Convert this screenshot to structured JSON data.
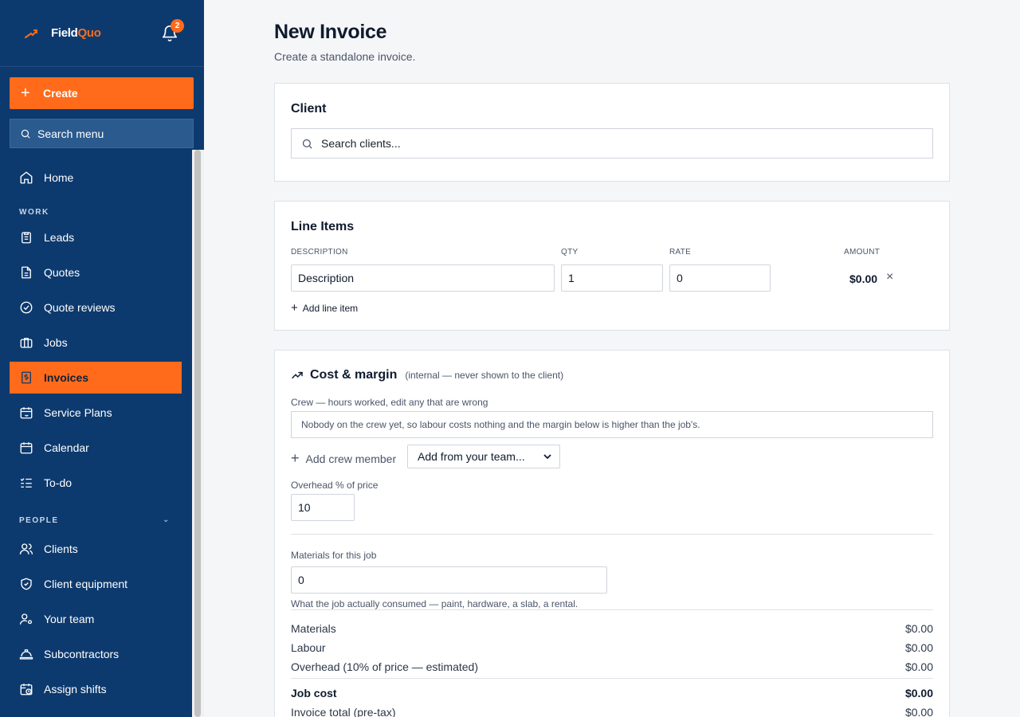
{
  "brand": {
    "name_part1": "Field",
    "name_part2": "Quo",
    "notification_count": "2"
  },
  "sidebar": {
    "create_label": "Create",
    "search_placeholder": "Search menu",
    "home": "Home",
    "section_work": "WORK",
    "work_items": [
      "Leads",
      "Quotes",
      "Quote reviews",
      "Jobs",
      "Invoices",
      "Service Plans",
      "Calendar",
      "To-do"
    ],
    "section_people": "PEOPLE",
    "people_items": [
      "Clients",
      "Client equipment",
      "Your team",
      "Subcontractors",
      "Assign shifts"
    ],
    "active_item": "Invoices"
  },
  "page": {
    "title": "New Invoice",
    "subtitle": "Create a standalone invoice."
  },
  "client": {
    "title": "Client",
    "search_placeholder": "Search clients..."
  },
  "line_items": {
    "title": "Line Items",
    "headers": {
      "description": "DESCRIPTION",
      "qty": "QTY",
      "rate": "RATE",
      "amount": "AMOUNT"
    },
    "rows": [
      {
        "description": "Description",
        "qty": "1",
        "rate": "0",
        "amount": "$0.00"
      }
    ],
    "add_label": "Add line item"
  },
  "cost_margin": {
    "title": "Cost & margin",
    "note": "(internal — never shown to the client)",
    "crew_label": "Crew — hours worked, edit any that are wrong",
    "crew_empty": "Nobody on the crew yet, so labour costs nothing and the margin below is higher than the job's.",
    "add_crew_label": "Add crew member",
    "team_select": "Add from your team...",
    "overhead_label": "Overhead % of price",
    "overhead_value": "10",
    "materials_label": "Materials for this job",
    "materials_value": "0",
    "materials_help": "What the job actually consumed — paint, hardware, a slab, a rental.",
    "summary": [
      {
        "label": "Materials",
        "value": "$0.00"
      },
      {
        "label": "Labour",
        "value": "$0.00"
      },
      {
        "label": "Overhead (10% of price — estimated)",
        "value": "$0.00"
      }
    ],
    "job_cost": {
      "label": "Job cost",
      "value": "$0.00"
    },
    "invoice_total": {
      "label": "Invoice total (pre-tax)",
      "value": "$0.00"
    }
  },
  "colors": {
    "sidebar_bg": "#0d3a6e",
    "accent": "#ff6b1a",
    "page_bg": "#f5f6f8"
  }
}
